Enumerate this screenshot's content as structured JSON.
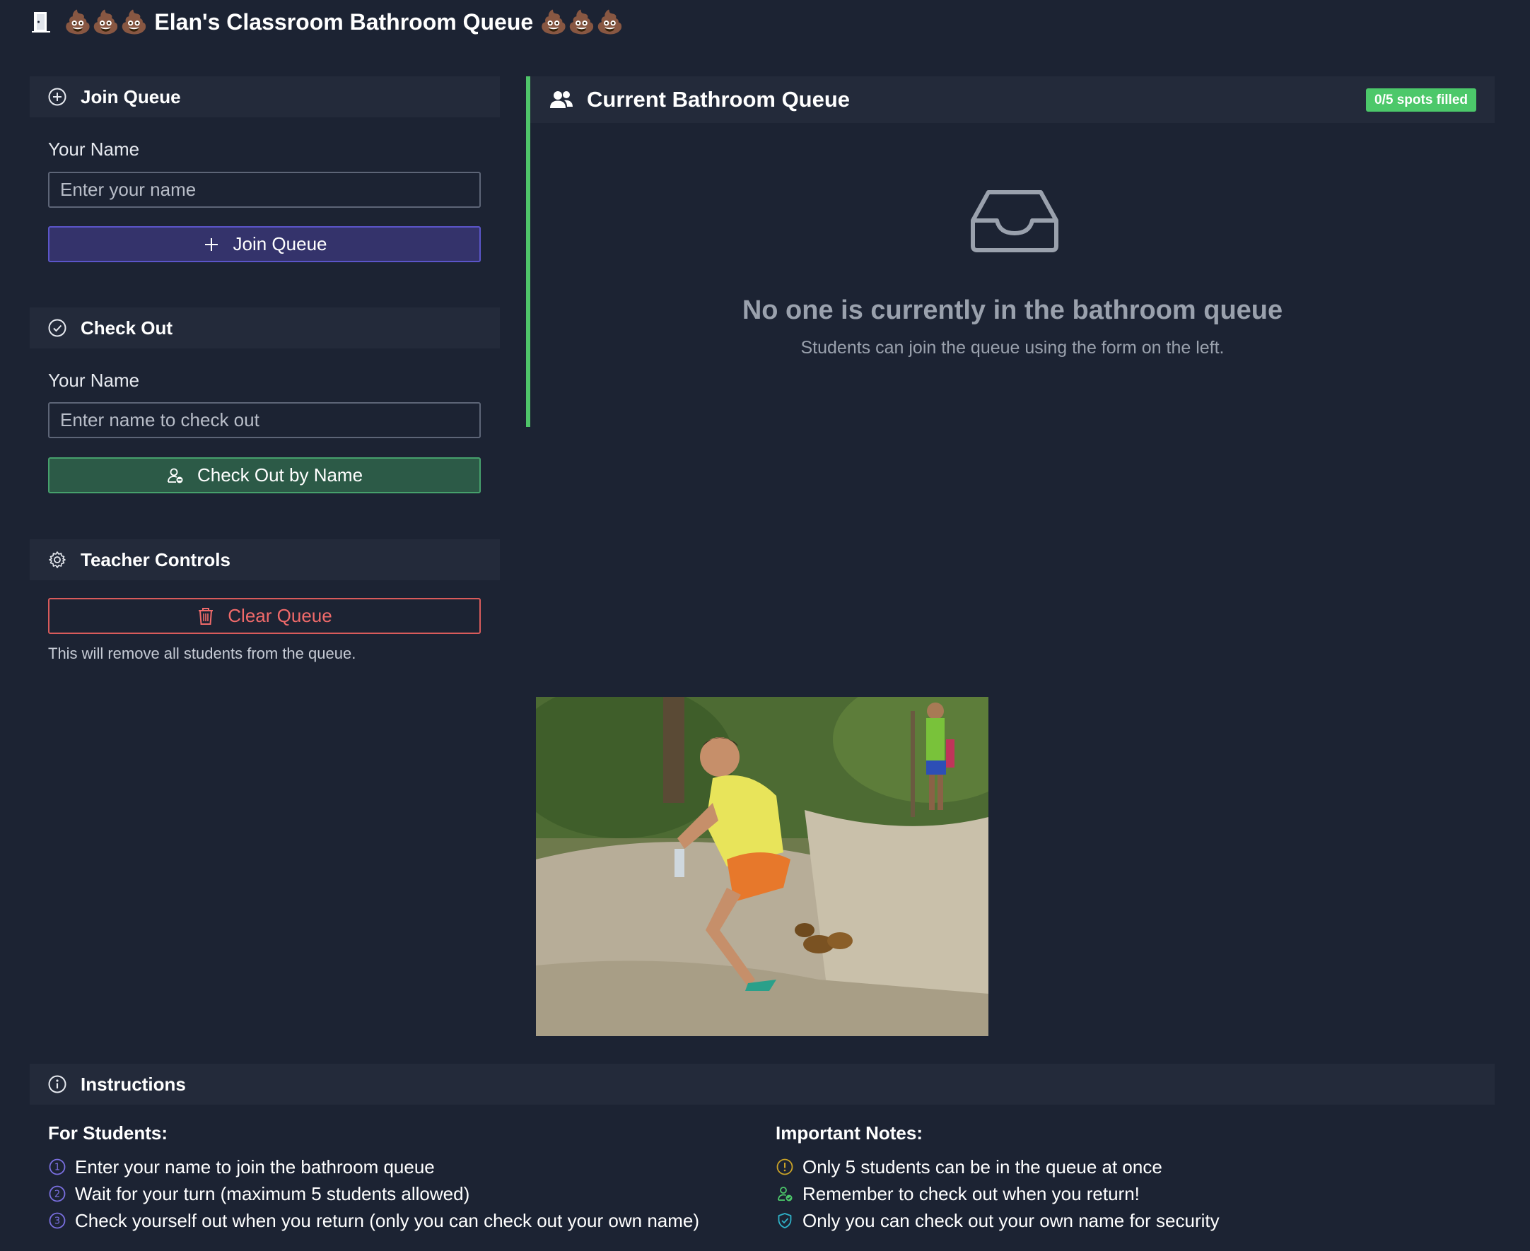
{
  "header": {
    "title": "💩💩💩 Elan's Classroom Bathroom Queue 💩💩💩",
    "icon": "door-icon"
  },
  "join_queue": {
    "title": "Join Queue",
    "icon": "plus-circle-icon",
    "name_label": "Your Name",
    "name_placeholder": "Enter your name",
    "name_value": "",
    "button_label": "Join Queue",
    "button_color": "#34336b"
  },
  "check_out": {
    "title": "Check Out",
    "icon": "check-circle-icon",
    "name_label": "Your Name",
    "name_placeholder": "Enter name to check out",
    "name_value": "",
    "button_label": "Check Out by Name",
    "button_color": "#2c5a47"
  },
  "teacher_controls": {
    "title": "Teacher Controls",
    "icon": "gear-icon",
    "clear_button_label": "Clear Queue",
    "clear_button_color": "#d95b5b",
    "help_text": "This will remove all students from the queue."
  },
  "queue": {
    "title": "Current Bathroom Queue",
    "icon": "people-icon",
    "badge": "0/5 spots filled",
    "badge_color": "#4cc86a",
    "accent_color": "#4fc56a",
    "empty_icon": "inbox-icon",
    "empty_title": "No one is currently in the bathroom queue",
    "empty_subtitle": "Students can join the queue using the form on the left."
  },
  "photo": {
    "description": "photo"
  },
  "instructions": {
    "title": "Instructions",
    "icon": "info-circle-icon",
    "students_heading": "For Students:",
    "students_items": [
      "Enter your name to join the bathroom queue",
      "Wait for your turn (maximum 5 students allowed)",
      "Check yourself out when you return (only you can check out your own name)"
    ],
    "notes_heading": "Important Notes:",
    "notes_items": [
      "Only 5 students can be in the queue at once",
      "Remember to check out when you return!",
      "Only you can check out your own name for security"
    ]
  }
}
